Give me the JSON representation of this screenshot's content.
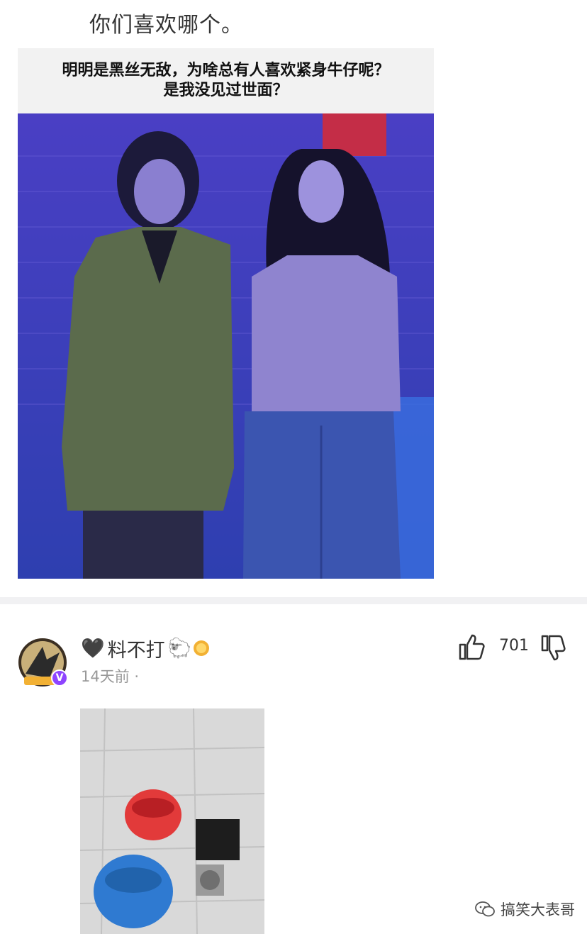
{
  "post": {
    "text": "你们喜欢哪个。"
  },
  "meme": {
    "caption_line1": "明明是黑丝无敌，为啥总有人喜欢紧身牛仔呢？",
    "caption_line2": "是我没见过世面？"
  },
  "comment": {
    "heart_emoji": "🖤",
    "username": "料不打",
    "sheep_emoji": "🐑",
    "time": "14天前",
    "time_dot": "·",
    "like_count": "701",
    "avatar_level": "V"
  },
  "watermark": {
    "text": "搞笑大表哥"
  },
  "colors": {
    "meme_bg": "#3d37b8",
    "divider": "#f1f1f3",
    "verified_badge": "#8e44ff",
    "gold_badge": "#f2b134"
  }
}
